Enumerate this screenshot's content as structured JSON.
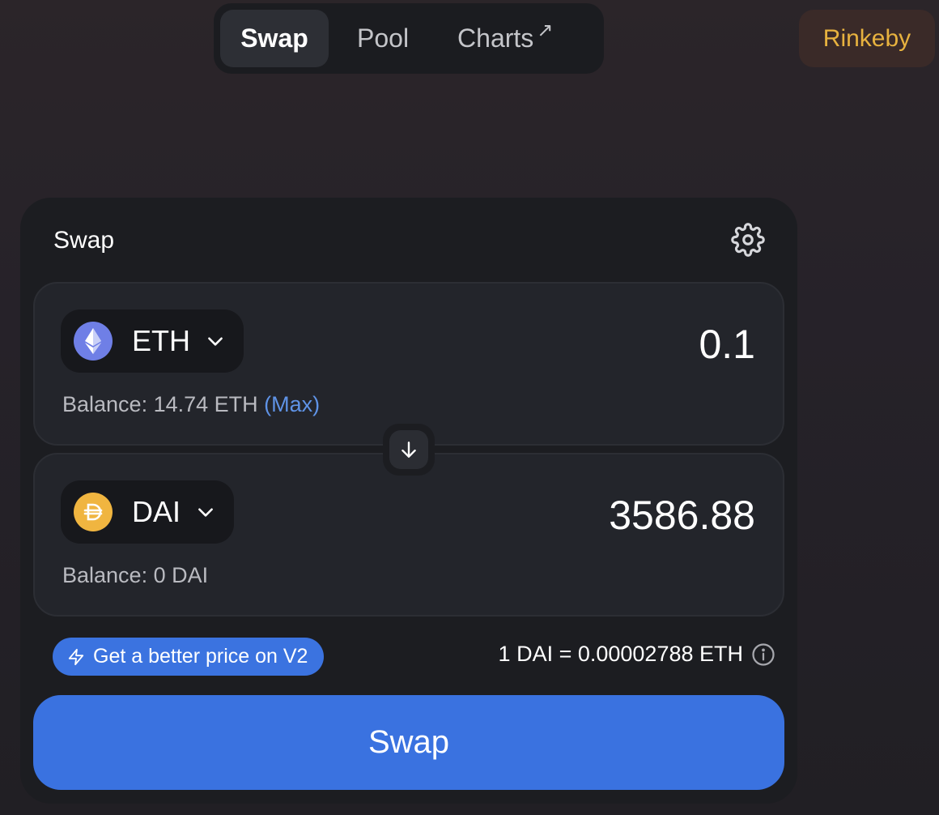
{
  "nav": {
    "tabs": [
      {
        "label": "Swap"
      },
      {
        "label": "Pool"
      },
      {
        "label": "Charts",
        "arrow": "↗"
      }
    ]
  },
  "network": {
    "label": "Rinkeby",
    "color": "#e7b23f"
  },
  "card": {
    "title": "Swap",
    "settings_icon": "gear-icon",
    "input": {
      "token": "ETH",
      "icon": "ethereum-icon",
      "amount": "0.1",
      "balance_label": "Balance: 14.74 ETH",
      "max_label": "(Max)"
    },
    "output": {
      "token": "DAI",
      "icon": "dai-icon",
      "amount": "3586.88",
      "balance_label": "Balance: 0 DAI"
    },
    "switch_icon": "arrow-down-icon",
    "promo": {
      "label": "Get a better price on V2",
      "icon": "lightning-icon"
    },
    "rate": {
      "label": "1 DAI = 0.00002788 ETH",
      "icon": "info-icon"
    },
    "swap_button": "Swap"
  },
  "colors": {
    "accent": "#3a72e0",
    "card_bg": "#1c1d21",
    "panel_bg": "#23252b",
    "max_link": "#5f93e6"
  }
}
